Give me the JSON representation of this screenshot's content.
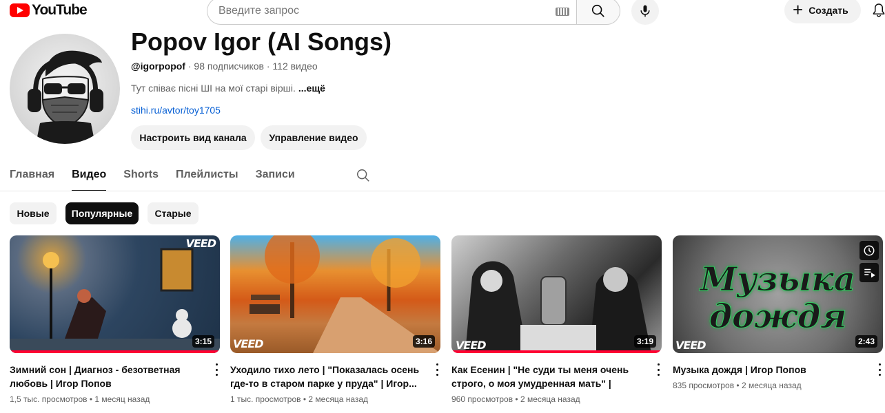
{
  "topbar": {
    "logo_text": "YouTube",
    "search_placeholder": "Введите запрос",
    "create_label": "Создать"
  },
  "channel": {
    "title": "Popov Igor (AI Songs)",
    "handle": "@igorpopof",
    "subscribers": " · 98 подписчиков · 112 видео",
    "description": "Тут співає пісні ШІ на мої старі вірші.",
    "more": "...ещё",
    "link": "stihi.ru/avtor/toy1705",
    "customize_label": "Настроить вид канала",
    "manage_label": "Управление видео"
  },
  "tabs": [
    {
      "label": "Главная"
    },
    {
      "label": "Видео",
      "active": true
    },
    {
      "label": "Shorts"
    },
    {
      "label": "Плейлисты"
    },
    {
      "label": "Записи"
    }
  ],
  "chips": [
    {
      "label": "Новые"
    },
    {
      "label": "Популярные",
      "active": true
    },
    {
      "label": "Старые"
    }
  ],
  "videos": [
    {
      "title": "Зимний сон | Диагноз - безответная любовь | Игор Попов",
      "views": "1,5 тыс. просмотров",
      "age": "1 месяц назад",
      "duration": "3:15",
      "badge": "VEED"
    },
    {
      "title": "Уходило тихо лето | \"Показалась осень где-то в старом парке у пруда\" | Игор...",
      "views": "1 тыс. просмотров",
      "age": "2 месяца назад",
      "duration": "3:16",
      "badge": "VEED"
    },
    {
      "title": "Как Есенин | \"Не суди ты меня очень строго, о моя умудренная мать\" | Игор...",
      "views": "960 просмотров",
      "age": "2 месяца назад",
      "duration": "3:19",
      "badge": "VEED"
    },
    {
      "title": "Музыка дождя | Игор Попов",
      "views": "835 просмотров",
      "age": "2 месяца назад",
      "duration": "2:43",
      "badge": "VEED",
      "thumb_text_1": "Музыка",
      "thumb_text_2": "дождя"
    }
  ],
  "colors": {
    "brand_red": "#ff0000",
    "progress_red": "#ff0033",
    "link_blue": "#065fd4",
    "chip_active": "#0f0f0f"
  }
}
